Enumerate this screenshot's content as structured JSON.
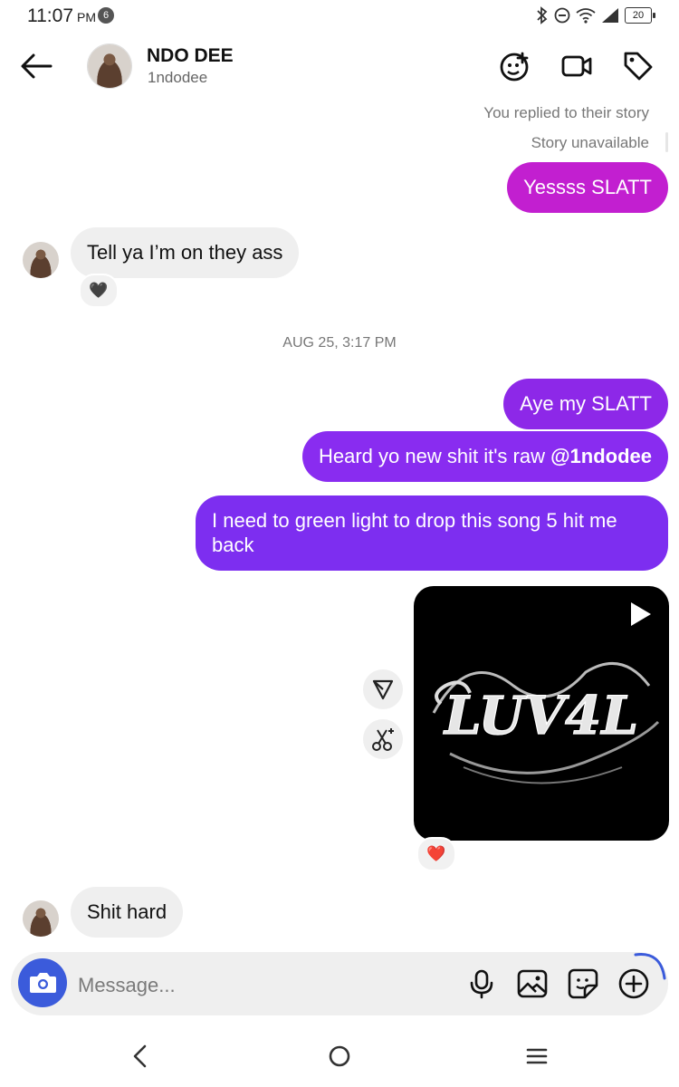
{
  "status": {
    "time": "11:07",
    "ampm": "PM",
    "notif_count": "6",
    "battery": "20"
  },
  "header": {
    "name": "NDO DEE",
    "handle": "1ndodee"
  },
  "story": {
    "replied": "You replied to their story",
    "unavailable": "Story unavailable"
  },
  "messages": {
    "m1": "Yessss SLATT",
    "m2": "Tell ya I’m on they ass",
    "m2_reaction": "🖤",
    "timestamp": "AUG 25, 3:17 PM",
    "m3": "Aye my SLATT",
    "m4": "Heard yo new shit it's raw ",
    "m4_mention": "@1ndodee",
    "m5": "I need to green light to drop this song 5 hit me back",
    "media_reaction": "❤️",
    "m6": "Shit hard"
  },
  "media": {
    "artwork_text": "LUV4L"
  },
  "composer": {
    "placeholder": "Message..."
  },
  "colors": {
    "bubble_magenta": "#c21fd0",
    "bubble_purple": "#8a2be2",
    "camera_blue": "#3b5bdb"
  }
}
